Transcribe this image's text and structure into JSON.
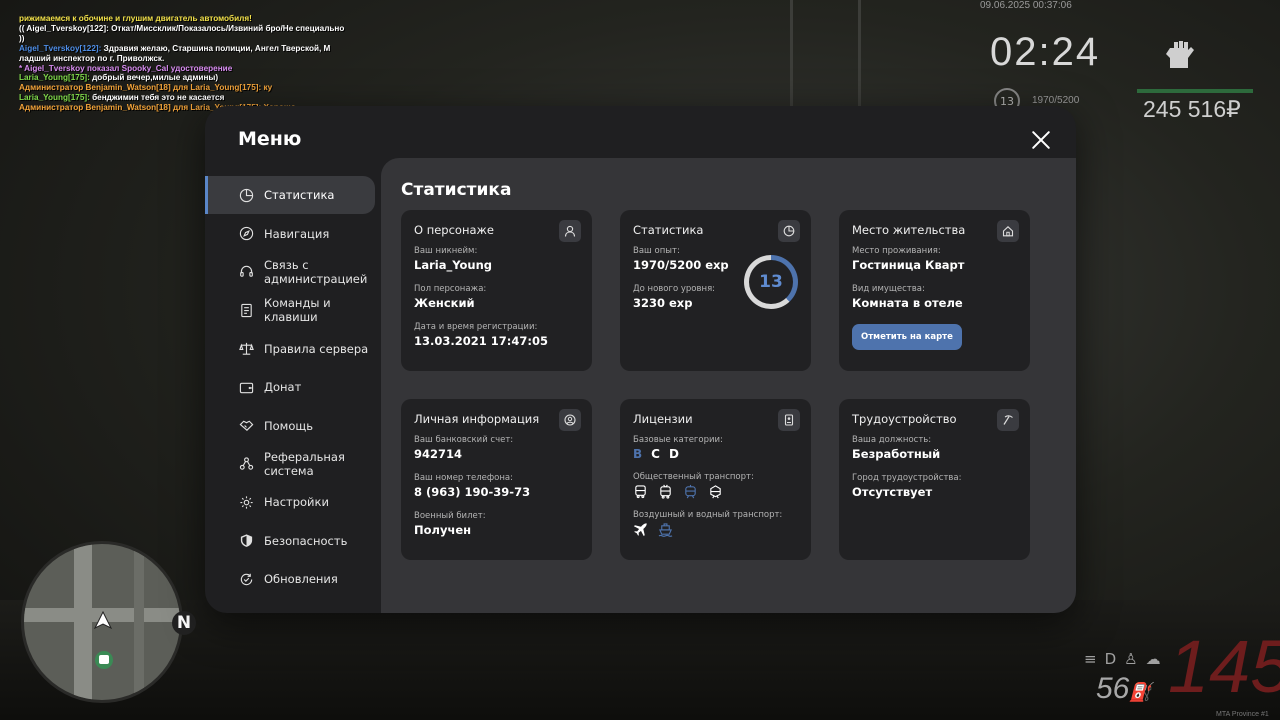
{
  "chat": [
    {
      "text": "рижимаемся к обочине и глушим двигатель автомобиля!",
      "color": "#f2e14a"
    },
    {
      "text": "(( Aigel_Tverskoy[122]: Откат/Миссклик/Показалось/Извиний бро/Не специально",
      "color": "#ffffff"
    },
    {
      "text": " ))",
      "color": "#ffffff"
    },
    {
      "text": "Aigel_Tverskoy[122]: Здравия желаю, Старшина полиции, Ангел Тверской, М",
      "color": "#ffffff",
      "prefix_color": "#4f8fe8",
      "prefix": "Aigel_Tverskoy[122]:"
    },
    {
      "text": "ладший инспектор по г. Приволжск.",
      "color": "#ffffff"
    },
    {
      "text": " * Aigel_Tverskoy показал Spooky_Cal удостоверение",
      "color": "#d88cf0"
    },
    {
      "text": "Laria_Young[175]: добрый вечер,милые админы)",
      "color": "#ffffff",
      "prefix_color": "#7fd94a",
      "prefix": "Laria_Young[175]:"
    },
    {
      "text": "Администратор Benjamin_Watson[18] для Laria_Young[175]: ку",
      "color": "#f2a33a"
    },
    {
      "text": "Laria_Young[175]: бенджимин тебя это не касается",
      "color": "#ffffff",
      "prefix_color": "#7fd94a",
      "prefix": "Laria_Young[175]:"
    },
    {
      "text": "Администратор Benjamin_Watson[18] для Laria_Young[175]: Хорошо",
      "color": "#f2a33a"
    }
  ],
  "hud": {
    "date": "09.06.2025 00:37:06",
    "clock": "02:24",
    "level": "13",
    "exp": "1970/5200",
    "money": "245 516₽",
    "speed": "145",
    "fuel": "56",
    "server": "MTA Province #1",
    "north": "N",
    "health": 1.0
  },
  "menu": {
    "title": "Меню",
    "sidebar": [
      {
        "label": "Статистика",
        "icon": "pie-chart-icon",
        "active": true
      },
      {
        "label": "Навигация",
        "icon": "compass-icon"
      },
      {
        "label": "Связь с администрацией",
        "icon": "headset-icon"
      },
      {
        "label": "Команды и клавиши",
        "icon": "document-icon"
      },
      {
        "label": "Правила сервера",
        "icon": "scales-icon"
      },
      {
        "label": "Донат",
        "icon": "wallet-icon"
      },
      {
        "label": "Помощь",
        "icon": "handshake-icon"
      },
      {
        "label": "Реферальная система",
        "icon": "network-icon"
      },
      {
        "label": "Настройки",
        "icon": "gear-icon"
      },
      {
        "label": "Безопасность",
        "icon": "shield-icon"
      },
      {
        "label": "Обновления",
        "icon": "refresh-check-icon"
      }
    ]
  },
  "stats": {
    "title": "Статистика",
    "character": {
      "title": "О персонаже",
      "icon": "user-icon",
      "nickname_label": "Ваш никнейм:",
      "nickname": "Laria_Young",
      "gender_label": "Пол персонажа:",
      "gender": "Женский",
      "reg_label": "Дата и время регистрации:",
      "reg_date": "13.03.2021 17:47:05"
    },
    "progress": {
      "title": "Статистика",
      "icon": "pie-chart-icon",
      "exp_label": "Ваш опыт:",
      "exp": "1970/5200 exp",
      "next_label": "До нового уровня:",
      "next": "3230 exp",
      "level": "13",
      "fraction": 0.38,
      "accent": "#4e73ad"
    },
    "residence": {
      "title": "Место жительства",
      "icon": "house-icon",
      "place_label": "Место проживания:",
      "place": "Гостиница Кварт",
      "property_label": "Вид имущества:",
      "property": "Комната в отеле",
      "button": "Отметить на карте"
    },
    "personal": {
      "title": "Личная информация",
      "icon": "user-circle-icon",
      "bank_label": "Ваш банковский счет:",
      "bank": "942714",
      "phone_label": "Ваш номер телефона:",
      "phone": "8 (963) 190-39-73",
      "military_label": "Военный билет:",
      "military": "Получен"
    },
    "licenses": {
      "title": "Лицензии",
      "icon": "id-card-icon",
      "basic_label": "Базовые категории:",
      "categories": [
        {
          "label": "B",
          "owned": false
        },
        {
          "label": "C",
          "owned": true
        },
        {
          "label": "D",
          "owned": true
        }
      ],
      "public_label": "Общественный транспорт:",
      "public": [
        {
          "icon": "bus-icon",
          "owned": true
        },
        {
          "icon": "trolleybus-icon",
          "owned": true
        },
        {
          "icon": "tram-icon",
          "owned": false
        },
        {
          "icon": "train-icon",
          "owned": true
        }
      ],
      "air_label": "Воздушный и водный транспорт:",
      "air": [
        {
          "icon": "plane-icon",
          "owned": true
        },
        {
          "icon": "boat-icon",
          "owned": false
        }
      ]
    },
    "job": {
      "title": "Трудоустройство",
      "icon": "pickaxe-icon",
      "position_label": "Ваша должность:",
      "position": "Безработный",
      "city_label": "Город трудоустройства:",
      "city": "Отсутствует"
    }
  }
}
